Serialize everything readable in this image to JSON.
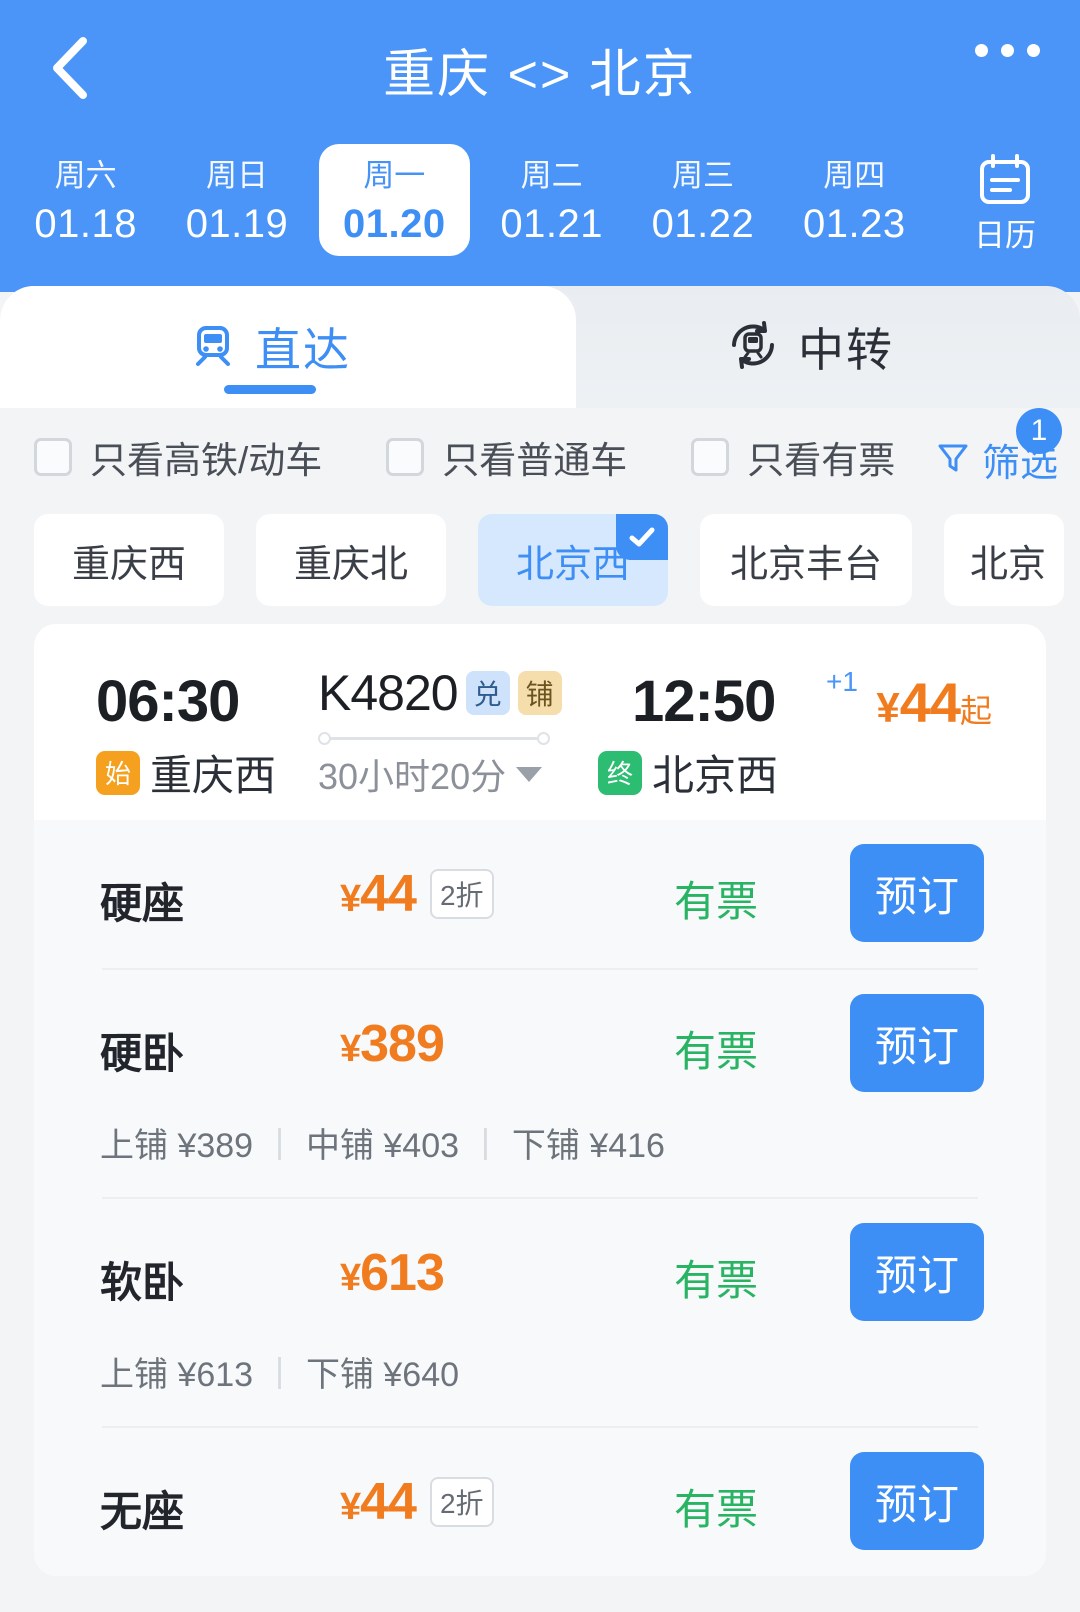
{
  "header": {
    "back_icon": "chevron-left-icon",
    "title": "重庆 <> 北京",
    "more_icon": "more-dots-icon",
    "dates": [
      {
        "dow": "周六",
        "day": "01.18",
        "active": false
      },
      {
        "dow": "周日",
        "day": "01.19",
        "active": false
      },
      {
        "dow": "周一",
        "day": "01.20",
        "active": true
      },
      {
        "dow": "周二",
        "day": "01.21",
        "active": false
      },
      {
        "dow": "周三",
        "day": "01.22",
        "active": false
      },
      {
        "dow": "周四",
        "day": "01.23",
        "active": false
      }
    ],
    "calendar": {
      "icon": "calendar-icon",
      "label": "日历"
    },
    "bg_color": "#4a95f7"
  },
  "tabs": [
    {
      "label": "直达",
      "icon": "train-front-icon",
      "active": true
    },
    {
      "label": "中转",
      "icon": "transfer-train-icon",
      "active": false
    }
  ],
  "filters": {
    "checkboxes": [
      {
        "label": "只看高铁/动车",
        "checked": false
      },
      {
        "label": "只看普通车",
        "checked": false
      },
      {
        "label": "只看有票",
        "checked": false
      }
    ],
    "filter_button": {
      "label": "筛选",
      "icon": "funnel-icon",
      "badge": "1"
    }
  },
  "station_chips": [
    {
      "label": "重庆西",
      "selected": false
    },
    {
      "label": "重庆北",
      "selected": false
    },
    {
      "label": "北京西",
      "selected": true
    },
    {
      "label": "北京丰台",
      "selected": false
    },
    {
      "label": "北京",
      "selected": false
    }
  ],
  "train": {
    "depart_time": "06:30",
    "depart_station": "重庆西",
    "depart_badge": "始",
    "train_no": "K4820",
    "tags": [
      "兑",
      "铺"
    ],
    "duration": "30小时20分",
    "arrive_time": "12:50",
    "arrive_day_offset": "+1",
    "arrive_station": "北京西",
    "arrive_badge": "终",
    "price_currency": "¥",
    "price_from": "44",
    "price_from_suffix": "起",
    "seats": [
      {
        "name": "硬座",
        "currency": "¥",
        "price": "44",
        "discount": "2折",
        "stock": "有票",
        "book": "预订",
        "berths": []
      },
      {
        "name": "硬卧",
        "currency": "¥",
        "price": "389",
        "discount": "",
        "stock": "有票",
        "book": "预订",
        "berths": [
          "上铺 ¥389",
          "中铺 ¥403",
          "下铺 ¥416"
        ]
      },
      {
        "name": "软卧",
        "currency": "¥",
        "price": "613",
        "discount": "",
        "stock": "有票",
        "book": "预订",
        "berths": [
          "上铺 ¥613",
          "下铺 ¥640"
        ]
      },
      {
        "name": "无座",
        "currency": "¥",
        "price": "44",
        "discount": "2折",
        "stock": "有票",
        "book": "预订",
        "berths": []
      }
    ]
  },
  "colors": {
    "brand_blue": "#3d8ef5",
    "header_blue": "#4a95f7",
    "price_orange": "#f07c1f",
    "stock_green": "#29b463",
    "start_badge": "#f5a11f",
    "end_badge": "#2dbd72"
  }
}
